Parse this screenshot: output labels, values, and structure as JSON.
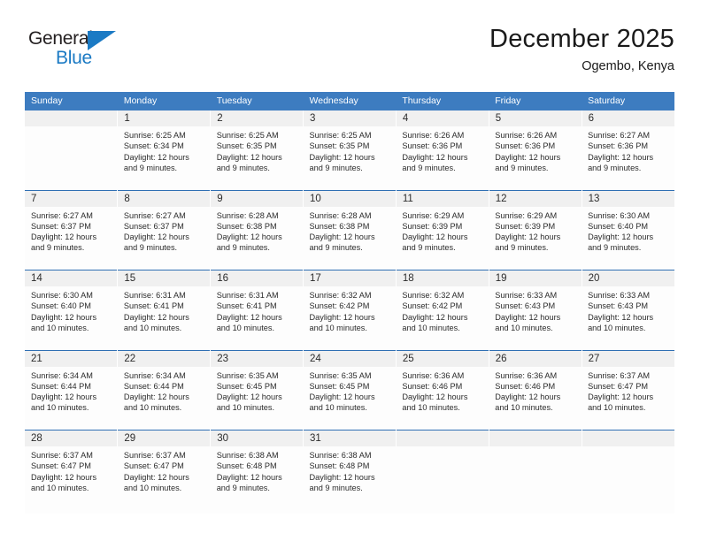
{
  "logo": {
    "word_top": "General",
    "word_bottom": "Blue",
    "triangle_color": "#1b7ac4",
    "text_color": "#231f20"
  },
  "header": {
    "month_title": "December 2025",
    "location": "Ogembo, Kenya"
  },
  "theme": {
    "header_blue": "#3d7cc0",
    "separator_blue": "#2f6fb3",
    "daynum_band": "#f0f0f0",
    "cell_bg": "#fdfdfd",
    "text": "#2b2b2b"
  },
  "calendar": {
    "weekday_headers": [
      "Sunday",
      "Monday",
      "Tuesday",
      "Wednesday",
      "Thursday",
      "Friday",
      "Saturday"
    ],
    "weeks": [
      [
        {
          "day": "",
          "lines": []
        },
        {
          "day": "1",
          "lines": [
            "Sunrise: 6:25 AM",
            "Sunset: 6:34 PM",
            "Daylight: 12 hours",
            "and 9 minutes."
          ]
        },
        {
          "day": "2",
          "lines": [
            "Sunrise: 6:25 AM",
            "Sunset: 6:35 PM",
            "Daylight: 12 hours",
            "and 9 minutes."
          ]
        },
        {
          "day": "3",
          "lines": [
            "Sunrise: 6:25 AM",
            "Sunset: 6:35 PM",
            "Daylight: 12 hours",
            "and 9 minutes."
          ]
        },
        {
          "day": "4",
          "lines": [
            "Sunrise: 6:26 AM",
            "Sunset: 6:36 PM",
            "Daylight: 12 hours",
            "and 9 minutes."
          ]
        },
        {
          "day": "5",
          "lines": [
            "Sunrise: 6:26 AM",
            "Sunset: 6:36 PM",
            "Daylight: 12 hours",
            "and 9 minutes."
          ]
        },
        {
          "day": "6",
          "lines": [
            "Sunrise: 6:27 AM",
            "Sunset: 6:36 PM",
            "Daylight: 12 hours",
            "and 9 minutes."
          ]
        }
      ],
      [
        {
          "day": "7",
          "lines": [
            "Sunrise: 6:27 AM",
            "Sunset: 6:37 PM",
            "Daylight: 12 hours",
            "and 9 minutes."
          ]
        },
        {
          "day": "8",
          "lines": [
            "Sunrise: 6:27 AM",
            "Sunset: 6:37 PM",
            "Daylight: 12 hours",
            "and 9 minutes."
          ]
        },
        {
          "day": "9",
          "lines": [
            "Sunrise: 6:28 AM",
            "Sunset: 6:38 PM",
            "Daylight: 12 hours",
            "and 9 minutes."
          ]
        },
        {
          "day": "10",
          "lines": [
            "Sunrise: 6:28 AM",
            "Sunset: 6:38 PM",
            "Daylight: 12 hours",
            "and 9 minutes."
          ]
        },
        {
          "day": "11",
          "lines": [
            "Sunrise: 6:29 AM",
            "Sunset: 6:39 PM",
            "Daylight: 12 hours",
            "and 9 minutes."
          ]
        },
        {
          "day": "12",
          "lines": [
            "Sunrise: 6:29 AM",
            "Sunset: 6:39 PM",
            "Daylight: 12 hours",
            "and 9 minutes."
          ]
        },
        {
          "day": "13",
          "lines": [
            "Sunrise: 6:30 AM",
            "Sunset: 6:40 PM",
            "Daylight: 12 hours",
            "and 9 minutes."
          ]
        }
      ],
      [
        {
          "day": "14",
          "lines": [
            "Sunrise: 6:30 AM",
            "Sunset: 6:40 PM",
            "Daylight: 12 hours",
            "and 10 minutes."
          ]
        },
        {
          "day": "15",
          "lines": [
            "Sunrise: 6:31 AM",
            "Sunset: 6:41 PM",
            "Daylight: 12 hours",
            "and 10 minutes."
          ]
        },
        {
          "day": "16",
          "lines": [
            "Sunrise: 6:31 AM",
            "Sunset: 6:41 PM",
            "Daylight: 12 hours",
            "and 10 minutes."
          ]
        },
        {
          "day": "17",
          "lines": [
            "Sunrise: 6:32 AM",
            "Sunset: 6:42 PM",
            "Daylight: 12 hours",
            "and 10 minutes."
          ]
        },
        {
          "day": "18",
          "lines": [
            "Sunrise: 6:32 AM",
            "Sunset: 6:42 PM",
            "Daylight: 12 hours",
            "and 10 minutes."
          ]
        },
        {
          "day": "19",
          "lines": [
            "Sunrise: 6:33 AM",
            "Sunset: 6:43 PM",
            "Daylight: 12 hours",
            "and 10 minutes."
          ]
        },
        {
          "day": "20",
          "lines": [
            "Sunrise: 6:33 AM",
            "Sunset: 6:43 PM",
            "Daylight: 12 hours",
            "and 10 minutes."
          ]
        }
      ],
      [
        {
          "day": "21",
          "lines": [
            "Sunrise: 6:34 AM",
            "Sunset: 6:44 PM",
            "Daylight: 12 hours",
            "and 10 minutes."
          ]
        },
        {
          "day": "22",
          "lines": [
            "Sunrise: 6:34 AM",
            "Sunset: 6:44 PM",
            "Daylight: 12 hours",
            "and 10 minutes."
          ]
        },
        {
          "day": "23",
          "lines": [
            "Sunrise: 6:35 AM",
            "Sunset: 6:45 PM",
            "Daylight: 12 hours",
            "and 10 minutes."
          ]
        },
        {
          "day": "24",
          "lines": [
            "Sunrise: 6:35 AM",
            "Sunset: 6:45 PM",
            "Daylight: 12 hours",
            "and 10 minutes."
          ]
        },
        {
          "day": "25",
          "lines": [
            "Sunrise: 6:36 AM",
            "Sunset: 6:46 PM",
            "Daylight: 12 hours",
            "and 10 minutes."
          ]
        },
        {
          "day": "26",
          "lines": [
            "Sunrise: 6:36 AM",
            "Sunset: 6:46 PM",
            "Daylight: 12 hours",
            "and 10 minutes."
          ]
        },
        {
          "day": "27",
          "lines": [
            "Sunrise: 6:37 AM",
            "Sunset: 6:47 PM",
            "Daylight: 12 hours",
            "and 10 minutes."
          ]
        }
      ],
      [
        {
          "day": "28",
          "lines": [
            "Sunrise: 6:37 AM",
            "Sunset: 6:47 PM",
            "Daylight: 12 hours",
            "and 10 minutes."
          ]
        },
        {
          "day": "29",
          "lines": [
            "Sunrise: 6:37 AM",
            "Sunset: 6:47 PM",
            "Daylight: 12 hours",
            "and 10 minutes."
          ]
        },
        {
          "day": "30",
          "lines": [
            "Sunrise: 6:38 AM",
            "Sunset: 6:48 PM",
            "Daylight: 12 hours",
            "and 9 minutes."
          ]
        },
        {
          "day": "31",
          "lines": [
            "Sunrise: 6:38 AM",
            "Sunset: 6:48 PM",
            "Daylight: 12 hours",
            "and 9 minutes."
          ]
        },
        {
          "day": "",
          "lines": []
        },
        {
          "day": "",
          "lines": []
        },
        {
          "day": "",
          "lines": []
        }
      ]
    ]
  }
}
